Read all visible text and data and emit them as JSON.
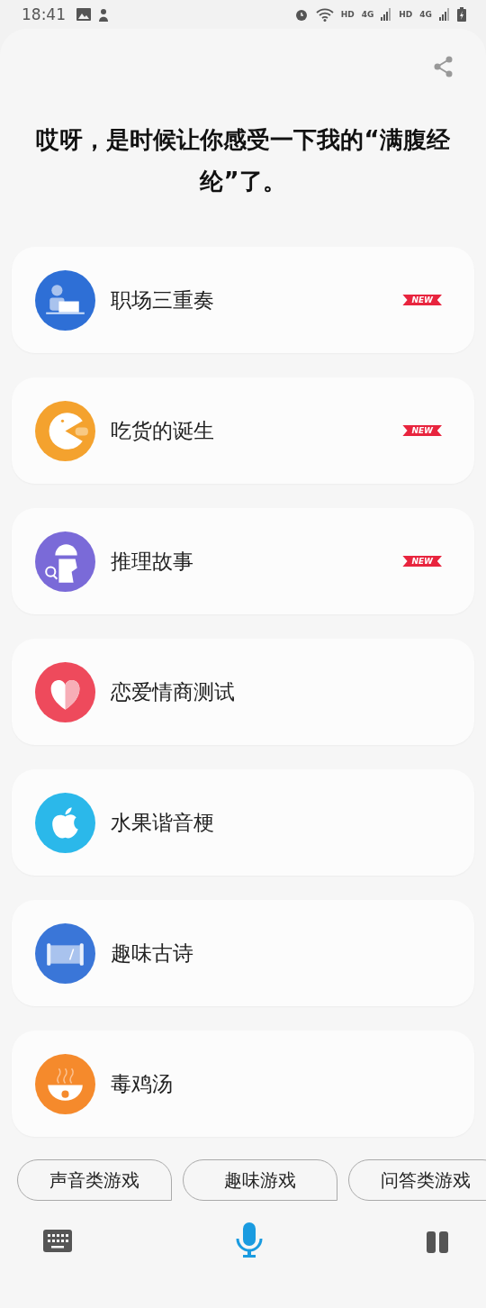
{
  "status_bar": {
    "time": "18:41",
    "network": [
      "HD",
      "4G",
      "HD",
      "4G"
    ]
  },
  "title": "哎呀，是时候让你感受一下我的“满腹经纶”了。",
  "items": [
    {
      "label": "职场三重奏",
      "kind": "worker",
      "color": "#2e6fd6",
      "badge": "NEW"
    },
    {
      "label": "吃货的诞生",
      "kind": "pacman",
      "color": "#f4a22e",
      "badge": "NEW"
    },
    {
      "label": "推理故事",
      "kind": "detective",
      "color": "#7a6ad8",
      "badge": "NEW"
    },
    {
      "label": "恋爱情商测试",
      "kind": "heart",
      "color": "#ee4a5c"
    },
    {
      "label": "水果谐音梗",
      "kind": "apple",
      "color": "#2bb8ea"
    },
    {
      "label": "趣味古诗",
      "kind": "scroll",
      "color": "#3a76d8"
    },
    {
      "label": "毒鸡汤",
      "kind": "soup",
      "color": "#f58a2c"
    }
  ],
  "chips": [
    "声音类游戏",
    "趣味游戏",
    "问答类游戏"
  ]
}
